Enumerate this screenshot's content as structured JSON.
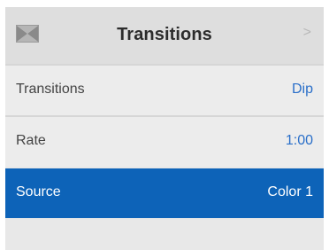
{
  "header": {
    "title": "Transitions",
    "icon": "transition-icon",
    "chevron": ">"
  },
  "rows": [
    {
      "label": "Transitions",
      "value": "Dip"
    },
    {
      "label": "Rate",
      "value": "1:00"
    },
    {
      "label": "Source",
      "value": "Color 1",
      "selected": true
    }
  ],
  "colors": {
    "accent": "#2a6fc9",
    "selected_bg": "#0d63b8"
  }
}
